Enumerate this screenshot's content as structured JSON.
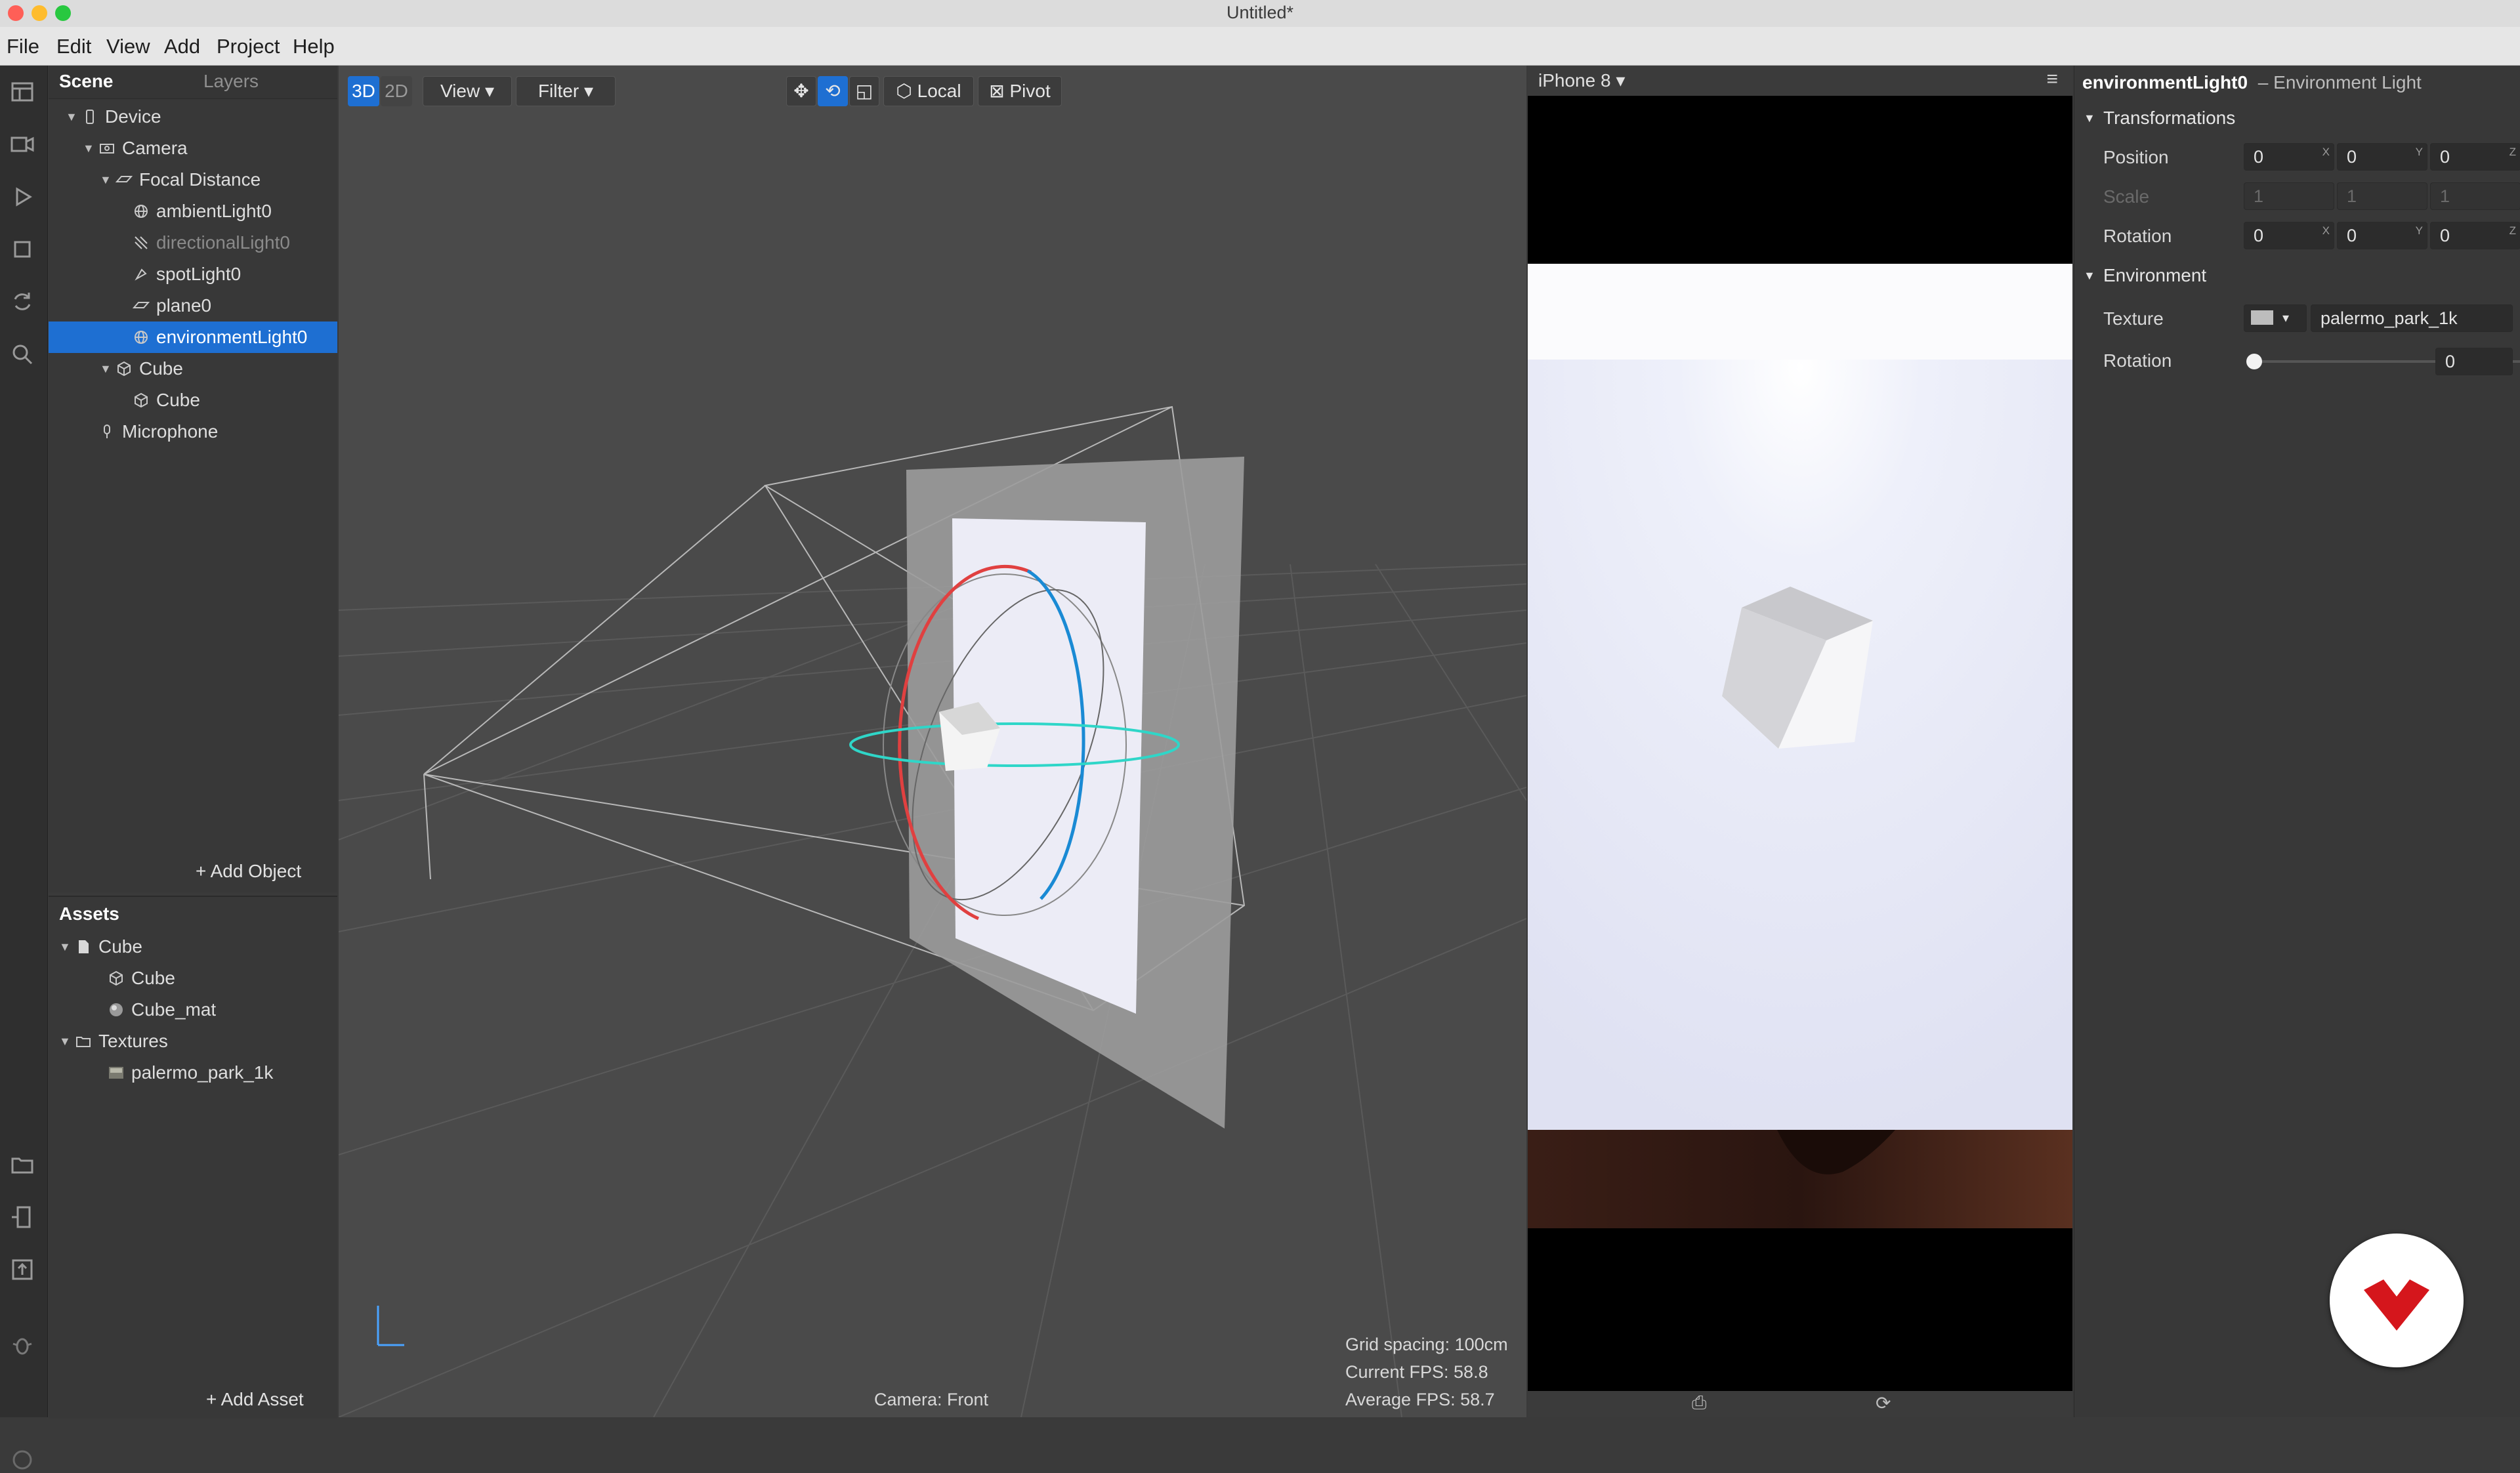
{
  "window": {
    "title": "Untitled*"
  },
  "menu": [
    "File",
    "Edit",
    "View",
    "Add",
    "Project",
    "Help"
  ],
  "scene_panel": {
    "tabs": [
      "Scene",
      "Layers"
    ],
    "tree": [
      {
        "label": "Device",
        "depth": 0,
        "expanded": true,
        "icon": "device-icon"
      },
      {
        "label": "Camera",
        "depth": 1,
        "expanded": true,
        "icon": "camera-icon"
      },
      {
        "label": "Focal Distance",
        "depth": 2,
        "expanded": true,
        "icon": "plane-icon"
      },
      {
        "label": "ambientLight0",
        "depth": 3,
        "icon": "globe-icon"
      },
      {
        "label": "directionalLight0",
        "depth": 3,
        "icon": "directional-light-icon",
        "dim": true
      },
      {
        "label": "spotLight0",
        "depth": 3,
        "icon": "spotlight-icon"
      },
      {
        "label": "plane0",
        "depth": 3,
        "icon": "plane-icon"
      },
      {
        "label": "environmentLight0",
        "depth": 3,
        "icon": "globe-icon",
        "selected": true
      },
      {
        "label": "Cube",
        "depth": 2,
        "expanded": true,
        "icon": "cube-icon"
      },
      {
        "label": "Cube",
        "depth": 3,
        "icon": "cube-icon"
      },
      {
        "label": "Microphone",
        "depth": 1,
        "icon": "microphone-icon"
      }
    ],
    "add_object": "+ Add Object"
  },
  "assets_panel": {
    "title": "Assets",
    "tree": [
      {
        "label": "Cube",
        "depth": 0,
        "expanded": true,
        "icon": "file-icon"
      },
      {
        "label": "Cube",
        "depth": 1,
        "icon": "cube-icon"
      },
      {
        "label": "Cube_mat",
        "depth": 1,
        "icon": "material-sphere-icon"
      },
      {
        "label": "Textures",
        "depth": 0,
        "expanded": true,
        "icon": "folder-icon"
      },
      {
        "label": "palermo_park_1k",
        "depth": 1,
        "icon": "image-thumbnail-icon"
      }
    ],
    "add_asset": "+ Add Asset"
  },
  "viewport": {
    "mode_3d": "3D",
    "mode_2d": "2D",
    "view_menu": "View",
    "filter_menu": "Filter",
    "local_btn": "Local",
    "pivot_btn": "Pivot",
    "camera_label": "Camera: Front",
    "grid_spacing": "Grid spacing: 100cm",
    "current_fps": "Current FPS:   58.8",
    "average_fps": "Average FPS:   58.7"
  },
  "device_preview": {
    "device": "iPhone 8"
  },
  "inspector": {
    "object_name": "environmentLight0",
    "object_type": "– Environment Light",
    "transformations_title": "Transformations",
    "position_label": "Position",
    "position": [
      "0",
      "0",
      "0"
    ],
    "scale_label": "Scale",
    "scale": [
      "1",
      "1",
      "1"
    ],
    "rotation_label": "Rotation",
    "rotation": [
      "0",
      "0",
      "0"
    ],
    "axes": [
      "X",
      "Y",
      "Z"
    ],
    "environment_title": "Environment",
    "texture_label": "Texture",
    "texture_value": "palermo_park_1k",
    "env_rotation_label": "Rotation",
    "env_rotation_value": "0",
    "env_rotation_fraction": 0.0
  },
  "colors": {
    "accent": "#1e6fd2",
    "panel": "#383838",
    "viewport": "#4a4a4a",
    "gizmo_red": "#e04040",
    "gizmo_blue": "#1a8ad4",
    "gizmo_cyan": "#2fd6c8",
    "logo_red": "#d5161c"
  }
}
